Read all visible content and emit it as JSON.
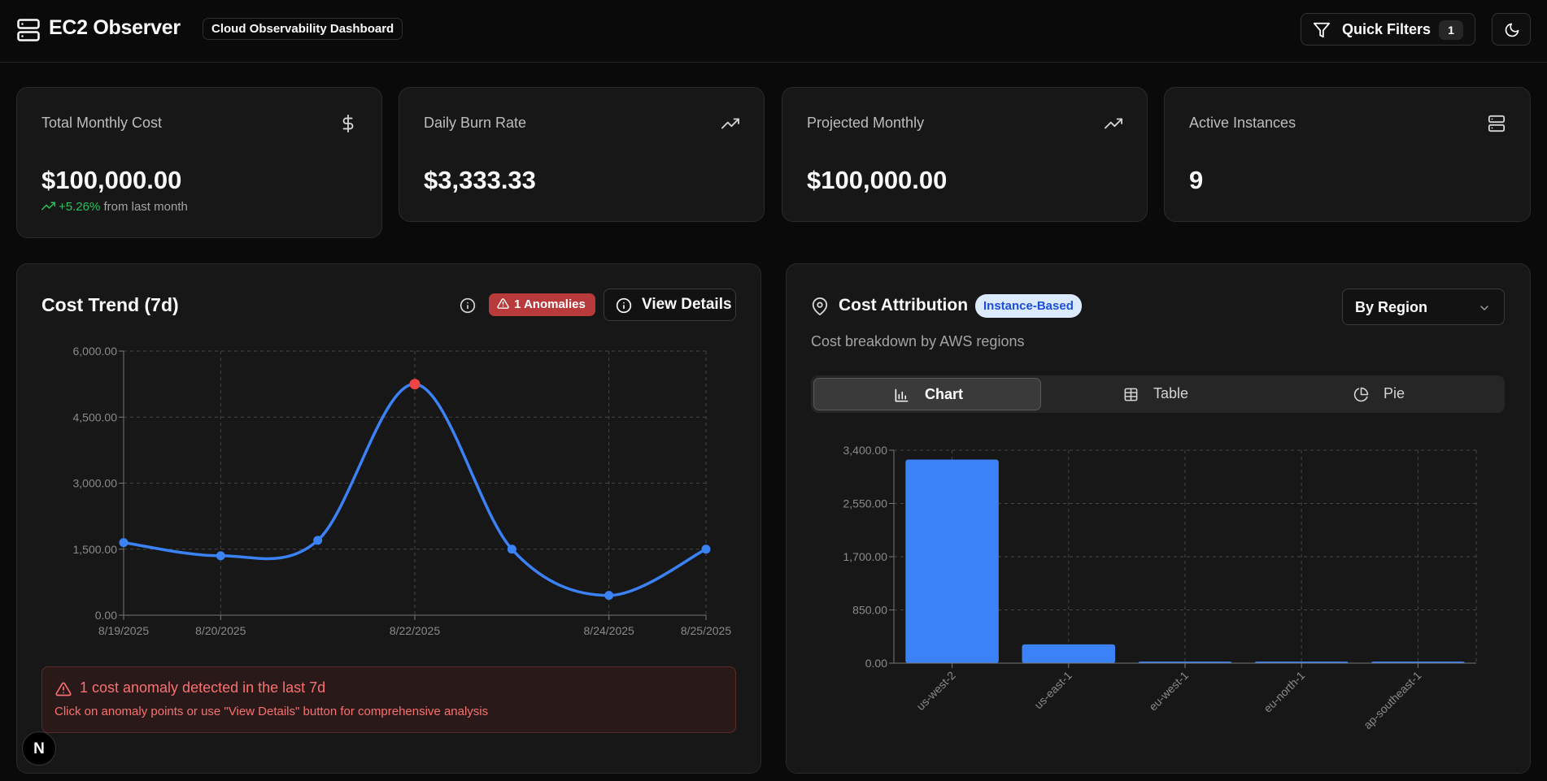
{
  "header": {
    "app_title": "EC2 Observer",
    "subtitle_badge": "Cloud Observability Dashboard",
    "quick_filters_label": "Quick Filters",
    "quick_filters_count": "1"
  },
  "stats": [
    {
      "label": "Total Monthly Cost",
      "value": "$100,000.00",
      "icon": "dollar-icon",
      "change": "+5.26%",
      "change_suffix": "from last month"
    },
    {
      "label": "Daily Burn Rate",
      "value": "$3,333.33",
      "icon": "trending-up-icon"
    },
    {
      "label": "Projected Monthly",
      "value": "$100,000.00",
      "icon": "trending-up-icon"
    },
    {
      "label": "Active Instances",
      "value": "9",
      "icon": "server-icon"
    }
  ],
  "cost_trend": {
    "title": "Cost Trend (7d)",
    "anomaly_badge": "1 Anomalies",
    "view_details_label": "View Details",
    "alert_title": "1 cost anomaly detected in the last 7d",
    "alert_subtitle": "Click on anomaly points or use \"View Details\" button for comprehensive analysis"
  },
  "cost_attribution": {
    "title": "Cost Attribution",
    "badge": "Instance-Based",
    "subtitle": "Cost breakdown by AWS regions",
    "group_by_selected": "By Region",
    "view_tabs": [
      {
        "label": "Chart",
        "icon": "bar-chart-icon",
        "active": true
      },
      {
        "label": "Table",
        "icon": "table-icon",
        "active": false
      },
      {
        "label": "Pie",
        "icon": "pie-chart-icon",
        "active": false
      }
    ]
  },
  "colors": {
    "accent": "#3b82f6",
    "anomaly": "#ef4444",
    "positive": "#22c55e"
  },
  "chart_data": [
    {
      "type": "line",
      "title": "",
      "x_ticks": [
        "8/19/2025",
        "8/20/2025",
        "8/22/2025",
        "8/24/2025",
        "8/25/2025"
      ],
      "y_ticks": [
        "0.00",
        "1,500.00",
        "3,000.00",
        "4,500.00",
        "6,000.00"
      ],
      "ylim": [
        0,
        6000
      ],
      "grid": true,
      "series": [
        {
          "values": [
            1650,
            1350,
            1700,
            5250,
            1500,
            450,
            1500
          ],
          "anomaly_index": 3
        }
      ]
    },
    {
      "type": "bar",
      "title": "",
      "categories": [
        "us-west-2",
        "us-east-1",
        "eu-west-1",
        "eu-north-1",
        "ap-southeast-1"
      ],
      "values": [
        3250,
        300,
        25,
        20,
        10
      ],
      "y_ticks": [
        "0.00",
        "850.00",
        "1,700.00",
        "2,550.00",
        "3,400.00"
      ],
      "ylim": [
        0,
        3400
      ],
      "grid": true
    }
  ]
}
